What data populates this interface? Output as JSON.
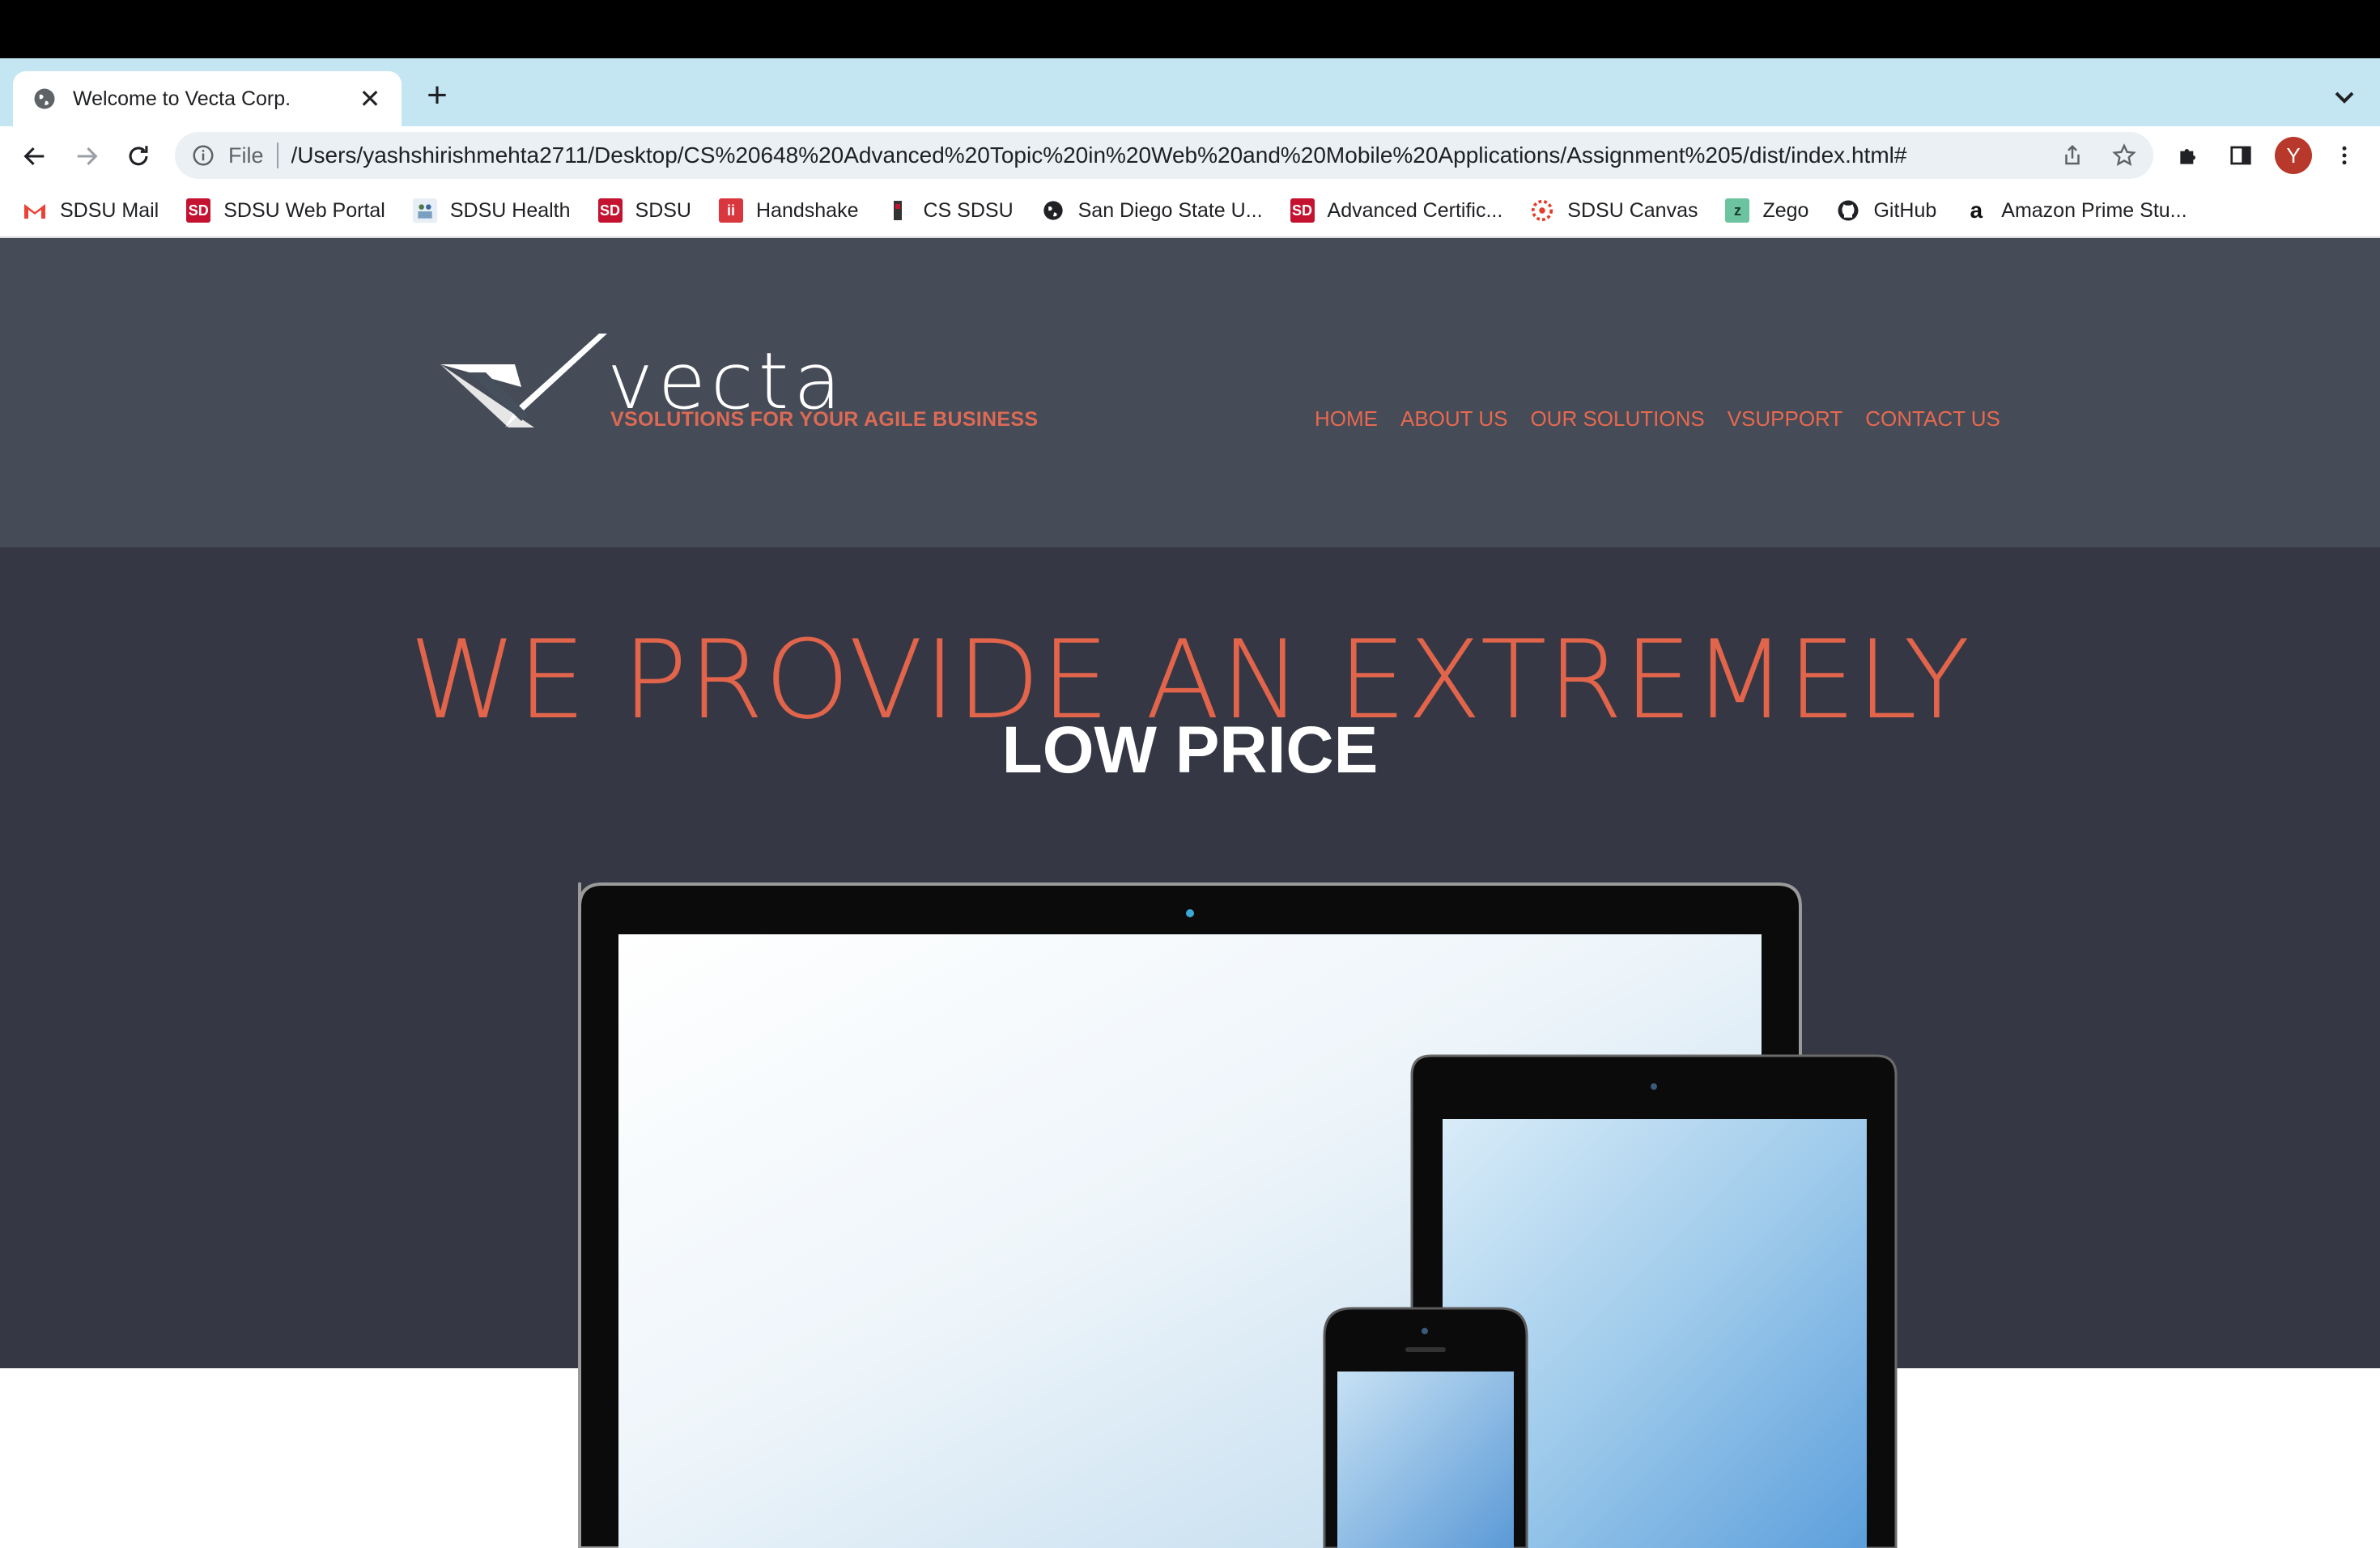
{
  "browser": {
    "tab_title": "Welcome to Vecta Corp.",
    "url_scheme": "File",
    "url": "/Users/yashshirishmehta2711/Desktop/CS%20648%20Advanced%20Topic%20in%20Web%20and%20Mobile%20Applications/Assignment%205/dist/index.html#",
    "profile_initial": "Y",
    "bookmarks": [
      {
        "label": "SDSU Mail",
        "icon": "gmail-icon"
      },
      {
        "label": "SDSU Web Portal",
        "icon": "sdsu-icon"
      },
      {
        "label": "SDSU Health",
        "icon": "health-icon"
      },
      {
        "label": "SDSU",
        "icon": "sdsu-icon"
      },
      {
        "label": "Handshake",
        "icon": "handshake-icon"
      },
      {
        "label": "CS SDSU",
        "icon": "cs-icon"
      },
      {
        "label": "San Diego State U...",
        "icon": "globe-icon"
      },
      {
        "label": "Advanced Certific...",
        "icon": "sdsu-icon"
      },
      {
        "label": "SDSU Canvas",
        "icon": "canvas-icon"
      },
      {
        "label": "Zego",
        "icon": "zego-icon"
      },
      {
        "label": "GitHub",
        "icon": "github-icon"
      },
      {
        "label": "Amazon Prime Stu...",
        "icon": "amazon-icon"
      }
    ]
  },
  "site": {
    "logo_text": "vecta",
    "tagline": "VSOLUTIONS FOR YOUR AGILE BUSINESS",
    "nav": [
      "HOME",
      "ABOUT US",
      "OUR SOLUTIONS",
      "VSUPPORT",
      "CONTACT US"
    ],
    "hero_line1": "WE PROVIDE AN EXTREMELY",
    "hero_line2": "LOW PRICE"
  },
  "colors": {
    "accent": "#e1644b",
    "header_bg": "#454b57",
    "hero_bg": "#353844"
  }
}
